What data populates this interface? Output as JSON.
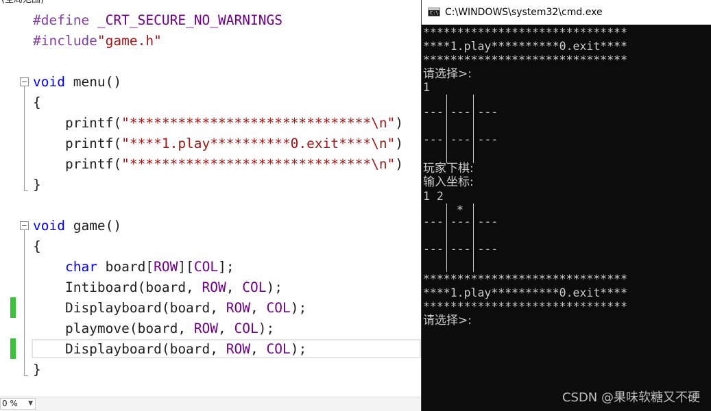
{
  "editor": {
    "scope_label": "(全局范围)",
    "lines": [
      {
        "id": "l1",
        "parts": [
          [
            "pp",
            "#define"
          ],
          [
            "p",
            " "
          ],
          [
            "def",
            "_CRT_SECURE_NO_WARNINGS"
          ]
        ]
      },
      {
        "id": "l2",
        "parts": [
          [
            "pp",
            "#include"
          ],
          [
            "str",
            "\"game.h\""
          ]
        ]
      },
      {
        "id": "l3",
        "parts": []
      },
      {
        "id": "l4",
        "parts": [
          [
            "kw",
            "void"
          ],
          [
            "p",
            " menu()"
          ]
        ]
      },
      {
        "id": "l5",
        "parts": [
          [
            "p",
            "{"
          ]
        ]
      },
      {
        "id": "l6",
        "parts": [
          [
            "p",
            "    printf("
          ],
          [
            "str",
            "\"******************************\\n\""
          ],
          [
            "p",
            ")"
          ]
        ]
      },
      {
        "id": "l7",
        "parts": [
          [
            "p",
            "    printf("
          ],
          [
            "str",
            "\"****1.play**********0.exit****\\n\""
          ],
          [
            "p",
            ")"
          ]
        ]
      },
      {
        "id": "l8",
        "parts": [
          [
            "p",
            "    printf("
          ],
          [
            "str",
            "\"******************************\\n\""
          ],
          [
            "p",
            ")"
          ]
        ]
      },
      {
        "id": "l9",
        "parts": [
          [
            "p",
            "}"
          ]
        ]
      },
      {
        "id": "l10",
        "parts": []
      },
      {
        "id": "l11",
        "parts": [
          [
            "kw",
            "void"
          ],
          [
            "p",
            " game()"
          ]
        ]
      },
      {
        "id": "l12",
        "parts": [
          [
            "p",
            "{"
          ]
        ]
      },
      {
        "id": "l13",
        "parts": [
          [
            "p",
            "    "
          ],
          [
            "kw",
            "char"
          ],
          [
            "p",
            " board["
          ],
          [
            "macro",
            "ROW"
          ],
          [
            "p",
            "]["
          ],
          [
            "macro",
            "COL"
          ],
          [
            "p",
            "];"
          ]
        ]
      },
      {
        "id": "l14",
        "parts": [
          [
            "p",
            "    Intiboard(board, "
          ],
          [
            "macro",
            "ROW"
          ],
          [
            "p",
            ", "
          ],
          [
            "macro",
            "COL"
          ],
          [
            "p",
            ");"
          ]
        ]
      },
      {
        "id": "l15",
        "parts": [
          [
            "p",
            "    Displayboard(board, "
          ],
          [
            "macro",
            "ROW"
          ],
          [
            "p",
            ", "
          ],
          [
            "macro",
            "COL"
          ],
          [
            "p",
            ");"
          ]
        ]
      },
      {
        "id": "l16",
        "parts": [
          [
            "p",
            "    playmove(board, "
          ],
          [
            "macro",
            "ROW"
          ],
          [
            "p",
            ", "
          ],
          [
            "macro",
            "COL"
          ],
          [
            "p",
            ");"
          ]
        ]
      },
      {
        "id": "l17",
        "parts": [
          [
            "p",
            "    Displayboard(board, "
          ],
          [
            "macro",
            "ROW"
          ],
          [
            "p",
            ", "
          ],
          [
            "macro",
            "COL"
          ],
          [
            "p",
            ");"
          ]
        ]
      },
      {
        "id": "l18",
        "parts": [
          [
            "p",
            "}"
          ]
        ]
      }
    ],
    "zoom": "0 %"
  },
  "console": {
    "title": "C:\\WINDOWS\\system32\\cmd.exe",
    "icon_text": "C:\\",
    "menu_border": "******************************",
    "menu_middle": "****1.play**********0.exit****",
    "prompt_select": "请选择>:",
    "input_1": "1",
    "board_row": "--- --- ---",
    "player_turn": "玩家下棋:",
    "enter_coords": "输入坐标:",
    "input_coords": "1 2",
    "star": "*"
  },
  "watermark": "CSDN @果味软糖又不硬",
  "colors": {
    "console_bg": "#0c0c0c",
    "console_fg": "#cccccc",
    "keyword": "#0000ff",
    "string": "#a31515",
    "macro": "#6f008a",
    "preprocessor": "#7f3f9f",
    "change_bar": "#3cc13b"
  }
}
